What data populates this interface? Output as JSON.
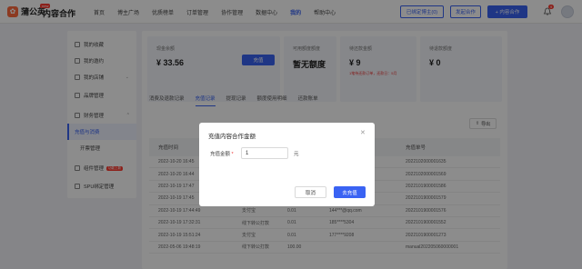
{
  "header": {
    "logo_text": "蒲公英",
    "logo_badge": "new",
    "product": "内容合作",
    "nav": [
      "首页",
      "博主广场",
      "优质榜单",
      "订单管理",
      "协作管理",
      "数据中心",
      "我的",
      "帮助中心"
    ],
    "active_nav": "我的",
    "bound_btn": "已绑定博主(0)",
    "publish_btn": "发起合作",
    "cooperate_btn": "+ 内容合作",
    "notif_count": "9"
  },
  "sidebar": {
    "items": [
      {
        "label": "我的收藏",
        "icon": "star-icon"
      },
      {
        "label": "我的邀约",
        "icon": "mail-icon"
      },
      {
        "label": "我的店铺",
        "icon": "shop-icon",
        "arrow": "⌄"
      },
      {
        "label": "品牌管理",
        "icon": "tag-icon"
      },
      {
        "label": "财务管理",
        "icon": "wallet-icon",
        "arrow": "^"
      },
      {
        "label": "充值与消费",
        "icon": "",
        "active": true
      },
      {
        "label": "开票管理",
        "icon": ""
      },
      {
        "label": "组件管理",
        "icon": "grid-icon",
        "badge": "功能上新"
      },
      {
        "label": "SPU绑定管理",
        "icon": "link-icon"
      }
    ]
  },
  "cards": [
    {
      "label": "现金余额",
      "value": "¥ 33.56",
      "button": "充值"
    },
    {
      "label": "可用额度额度",
      "value": "暂无额度"
    },
    {
      "label": "待还款金额",
      "value": "¥ 9",
      "note": "1笔待还款订单，还款日：5月"
    },
    {
      "label": "待退款额度",
      "value": "¥ 0"
    }
  ],
  "tabs": [
    "消费及退款记录",
    "充值记录",
    "提现记录",
    "额度使用明细",
    "还款账单"
  ],
  "active_tab": "充值记录",
  "export_label": "导出",
  "table": {
    "headers": [
      "充值时间",
      "",
      "",
      "",
      "充值单号"
    ],
    "rows": [
      [
        "2022-10-20 16:45",
        "",
        "",
        "",
        "2022102000001635"
      ],
      [
        "2022-10-20 16:44",
        "",
        "",
        "",
        "2022102000001569"
      ],
      [
        "2022-10-19 17:47",
        "",
        "",
        "",
        "2022101900001586"
      ],
      [
        "2022-10-19 17:45",
        "",
        "",
        "",
        "2022101900001579"
      ],
      [
        "2022-10-19 17:44:49",
        "支付宝",
        "0.01",
        "144***@qq.com",
        "2022101900001576"
      ],
      [
        "2022-10-19 17:32:31",
        "线下转公打款",
        "0.01",
        "185****5304",
        "2022101900001552"
      ],
      [
        "2022-10-19 15:51:24",
        "支付宝",
        "0.01",
        "177****9208",
        "2022101900001273"
      ],
      [
        "2022-05-06 19:48:19",
        "线下转公打款",
        "100.00",
        "",
        "manual202205060000001"
      ]
    ]
  },
  "modal": {
    "title": "充值内容合作金额",
    "amount_label": "充值金额",
    "required_mark": "*",
    "amount_value": "1",
    "unit": "元",
    "cancel": "取消",
    "confirm": "去充值"
  }
}
